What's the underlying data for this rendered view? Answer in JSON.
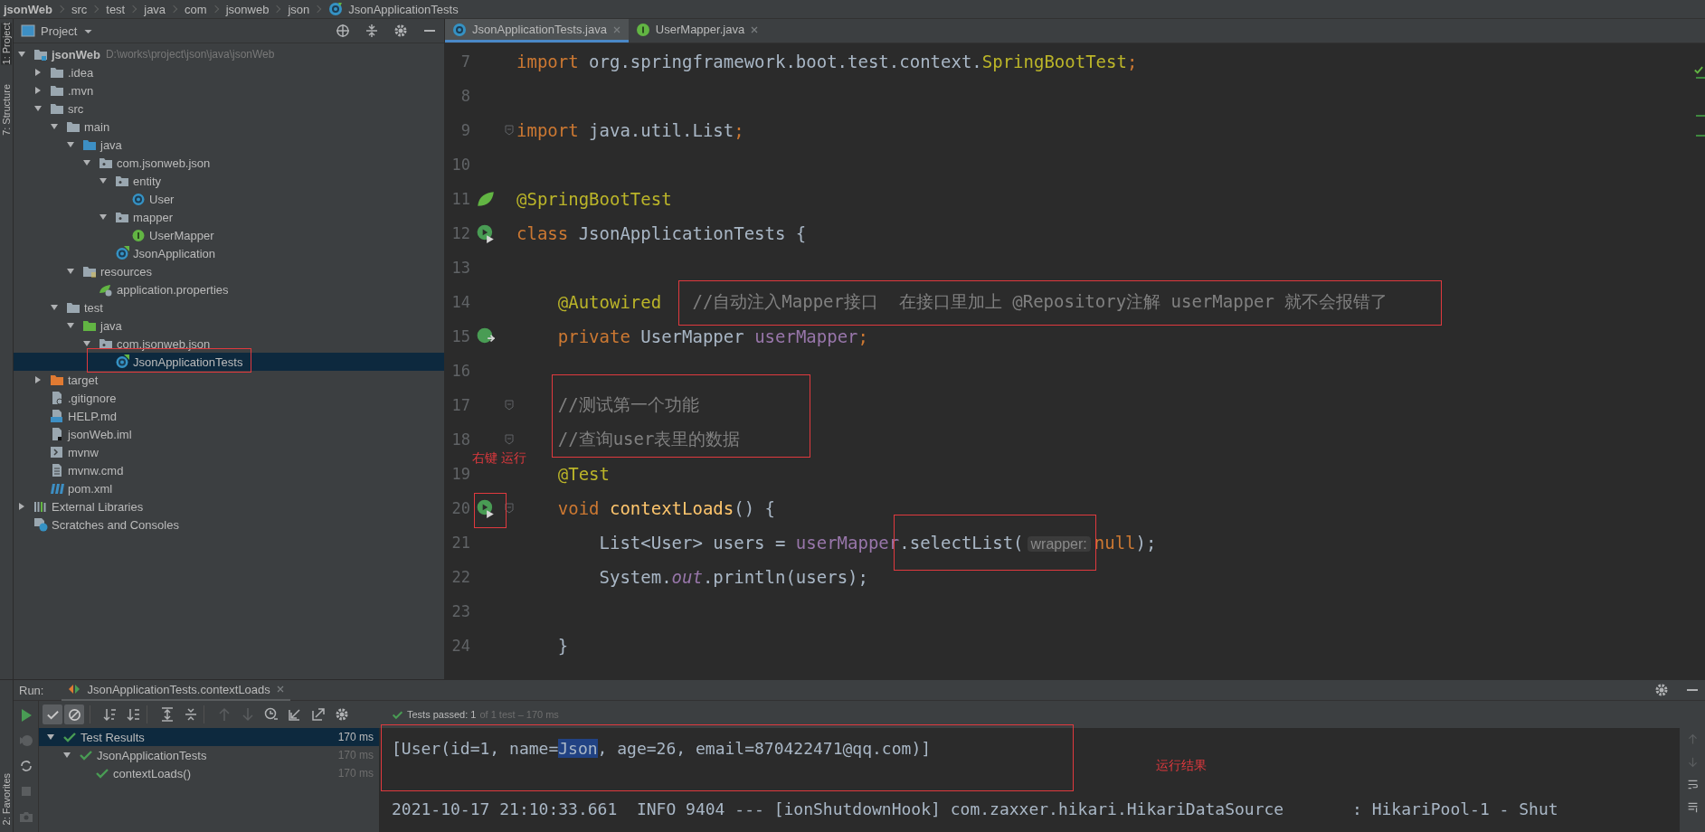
{
  "breadcrumb": [
    {
      "label": "jsonWeb",
      "kind": "project"
    },
    {
      "label": "src",
      "kind": "folder"
    },
    {
      "label": "test",
      "kind": "folder"
    },
    {
      "label": "java",
      "kind": "folder"
    },
    {
      "label": "com",
      "kind": "folder"
    },
    {
      "label": "jsonweb",
      "kind": "folder"
    },
    {
      "label": "json",
      "kind": "folder"
    },
    {
      "label": "JsonApplicationTests",
      "kind": "class"
    }
  ],
  "tool_strip": {
    "top": [
      "1: Project",
      "7: Structure"
    ],
    "bottom": [
      "2: Favorites"
    ]
  },
  "project": {
    "title": "Project",
    "tree": [
      {
        "label": "jsonWeb",
        "path": "D:\\works\\project\\json\\java\\jsonWeb",
        "kind": "project",
        "expanded": true,
        "selected": false,
        "children": [
          {
            "label": ".idea",
            "kind": "folder",
            "expanded": false,
            "selected": false
          },
          {
            "label": ".mvn",
            "kind": "folder",
            "expanded": false,
            "selected": false
          },
          {
            "label": "src",
            "kind": "folder",
            "expanded": true,
            "selected": false,
            "children": [
              {
                "label": "main",
                "kind": "folder",
                "expanded": true,
                "selected": false,
                "children": [
                  {
                    "label": "java",
                    "kind": "source-folder",
                    "expanded": true,
                    "selected": false,
                    "children": [
                      {
                        "label": "com.jsonweb.json",
                        "kind": "package",
                        "expanded": true,
                        "selected": false,
                        "children": [
                          {
                            "label": "entity",
                            "kind": "package",
                            "expanded": true,
                            "selected": false,
                            "children": [
                              {
                                "label": "User",
                                "kind": "class",
                                "selected": false
                              }
                            ]
                          },
                          {
                            "label": "mapper",
                            "kind": "package",
                            "expanded": true,
                            "selected": false,
                            "children": [
                              {
                                "label": "UserMapper",
                                "kind": "interface",
                                "selected": false
                              }
                            ]
                          },
                          {
                            "label": "JsonApplication",
                            "kind": "spring-class",
                            "selected": false
                          }
                        ]
                      }
                    ]
                  },
                  {
                    "label": "resources",
                    "kind": "resources-folder",
                    "expanded": true,
                    "selected": false,
                    "children": [
                      {
                        "label": "application.properties",
                        "kind": "properties",
                        "selected": false
                      }
                    ]
                  }
                ]
              },
              {
                "label": "test",
                "kind": "folder",
                "expanded": true,
                "selected": false,
                "children": [
                  {
                    "label": "java",
                    "kind": "test-folder",
                    "expanded": true,
                    "selected": false,
                    "children": [
                      {
                        "label": "com.jsonweb.json",
                        "kind": "package",
                        "expanded": true,
                        "selected": false,
                        "children": [
                          {
                            "label": "JsonApplicationTests",
                            "kind": "spring-class",
                            "selected": true
                          }
                        ]
                      }
                    ]
                  }
                ]
              }
            ]
          },
          {
            "label": "target",
            "kind": "excluded-folder",
            "expanded": false,
            "selected": false
          },
          {
            "label": ".gitignore",
            "kind": "gitignore",
            "selected": false
          },
          {
            "label": "HELP.md",
            "kind": "markdown",
            "selected": false
          },
          {
            "label": "jsonWeb.iml",
            "kind": "iml",
            "selected": false
          },
          {
            "label": "mvnw",
            "kind": "shell",
            "selected": false
          },
          {
            "label": "mvnw.cmd",
            "kind": "cmd",
            "selected": false
          },
          {
            "label": "pom.xml",
            "kind": "maven",
            "selected": false
          }
        ]
      },
      {
        "label": "External Libraries",
        "kind": "libraries",
        "expanded": false,
        "selected": false
      },
      {
        "label": "Scratches and Consoles",
        "kind": "scratches",
        "selected": false
      }
    ]
  },
  "editor": {
    "tabs": [
      {
        "label": "JsonApplicationTests.java",
        "kind": "class",
        "selected": true
      },
      {
        "label": "UserMapper.java",
        "kind": "interface",
        "selected": false
      }
    ],
    "lines": [
      {
        "number": "7",
        "kind": "plain",
        "fold": false,
        "segments": [
          {
            "text": "import",
            "kind": "keyword"
          },
          {
            "text": " org.springframework.boot.test.context.",
            "kind": "plain"
          },
          {
            "text": "SpringBootTest",
            "kind": "annotation"
          },
          {
            "text": ";",
            "kind": "keyword"
          }
        ]
      },
      {
        "number": "8",
        "kind": "plain",
        "fold": false
      },
      {
        "number": "9",
        "kind": "plain",
        "fold": true,
        "segments": [
          {
            "text": "import",
            "kind": "keyword"
          },
          {
            "text": " java.util.List",
            "kind": "plain"
          },
          {
            "text": ";",
            "kind": "keyword"
          }
        ]
      },
      {
        "number": "10",
        "kind": "plain",
        "fold": false
      },
      {
        "number": "11",
        "kind": "spring",
        "fold": false,
        "segments": [
          {
            "text": "@SpringBootTest",
            "kind": "annotation"
          }
        ]
      },
      {
        "number": "12",
        "kind": "run-test",
        "fold": false,
        "segments": [
          {
            "text": "class",
            "kind": "keyword"
          },
          {
            "text": " JsonApplicationTests {",
            "kind": "plain"
          }
        ]
      },
      {
        "number": "13",
        "kind": "plain",
        "fold": false
      },
      {
        "number": "14",
        "kind": "plain",
        "fold": false,
        "segments": [
          {
            "text": "    @Autowired   ",
            "kind": "annotation"
          },
          {
            "text": "//自动注入Mapper接口  在接口里加上 @Repository注解 userMapper 就不会报错了",
            "kind": "comment"
          }
        ]
      },
      {
        "number": "15",
        "kind": "bean",
        "fold": false,
        "segments": [
          {
            "text": "    private",
            "kind": "keyword"
          },
          {
            "text": " UserMapper ",
            "kind": "plain"
          },
          {
            "text": "userMapper",
            "kind": "field"
          },
          {
            "text": ";",
            "kind": "keyword"
          }
        ]
      },
      {
        "number": "16",
        "kind": "plain",
        "fold": false
      },
      {
        "number": "17",
        "kind": "plain",
        "fold": true,
        "segments": [
          {
            "text": "    //测试第一个功能",
            "kind": "comment"
          }
        ]
      },
      {
        "number": "18",
        "kind": "plain",
        "fold": true,
        "segments": [
          {
            "text": "    //查询user表里的数据",
            "kind": "comment"
          }
        ]
      },
      {
        "number": "19",
        "kind": "plain",
        "fold": false,
        "segments": [
          {
            "text": "    @Test",
            "kind": "annotation"
          }
        ]
      },
      {
        "number": "20",
        "kind": "run-test",
        "fold": true,
        "segments": [
          {
            "text": "    void ",
            "kind": "keyword"
          },
          {
            "text": "contextLoads",
            "kind": "method"
          },
          {
            "text": "() {",
            "kind": "plain"
          }
        ]
      },
      {
        "number": "21",
        "kind": "plain",
        "fold": false,
        "segments": [
          {
            "text": "        List<User> users = ",
            "kind": "plain"
          },
          {
            "text": "userMapper",
            "kind": "field"
          },
          {
            "text": ".selectList(",
            "kind": "plain"
          },
          {
            "text": "wrapper:",
            "kind": "hint"
          },
          {
            "text": "null",
            "kind": "keyword"
          },
          {
            "text": ");",
            "kind": "plain"
          }
        ]
      },
      {
        "number": "22",
        "kind": "plain",
        "fold": false,
        "segments": [
          {
            "text": "        System.",
            "kind": "plain"
          },
          {
            "text": "out",
            "kind": "static"
          },
          {
            "text": ".println(users);",
            "kind": "plain"
          }
        ]
      },
      {
        "number": "23",
        "kind": "plain",
        "fold": false
      },
      {
        "number": "24",
        "kind": "plain",
        "fold": false,
        "segments": [
          {
            "text": "    }",
            "kind": "plain"
          }
        ]
      }
    ]
  },
  "run": {
    "label": "Run:",
    "tab": "JsonApplicationTests.contextLoads",
    "toggles": [
      {
        "kind": "passed",
        "on": true
      },
      {
        "kind": "ignored",
        "on": true
      }
    ],
    "tests": [
      {
        "label": "Test Results",
        "time": "170 ms",
        "expanded": true,
        "selected": true,
        "children": [
          {
            "label": "JsonApplicationTests",
            "time": "170 ms",
            "expanded": true,
            "selected": false,
            "children": [
              {
                "label": "contextLoads()",
                "time": "170 ms",
                "selected": false
              }
            ]
          }
        ]
      }
    ],
    "status": {
      "label": "Tests passed: 1",
      "detail": "of 1 test – 170 ms"
    },
    "output": [
      {
        "text": "[User(id=1, name=",
        "selected": false
      },
      {
        "text": "Json",
        "selected": true
      },
      {
        "text": ", age=26, email=870422471@qq.com)]",
        "selected": false
      }
    ],
    "log": "2021-10-17 21:10:33.661  INFO 9404 --- [ionShutdownHook] com.zaxxer.hikari.HikariDataSource       : HikariPool-1 - Shut"
  },
  "annotations": [
    "右键 运行",
    "运行结果"
  ]
}
